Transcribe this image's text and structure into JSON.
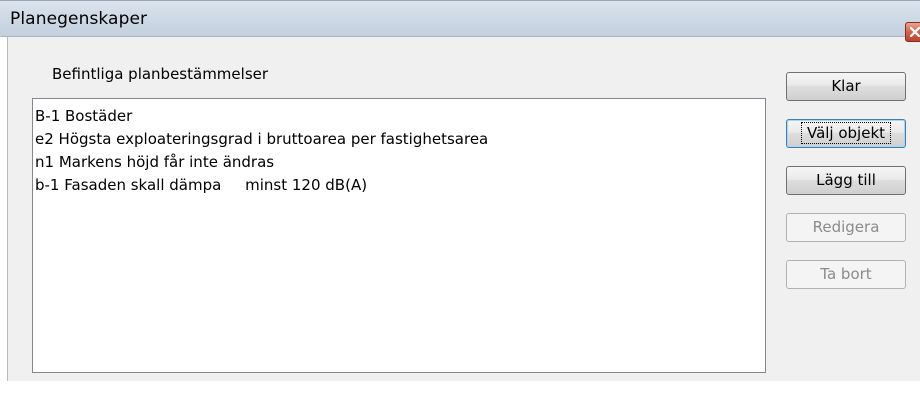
{
  "window": {
    "title": "Planegenskaper",
    "close_icon": "close-icon"
  },
  "group": {
    "label": "Befintliga planbestämmelser"
  },
  "list": {
    "items": [
      "B-1 Bostäder",
      "e2 Högsta exploateringsgrad i bruttoarea per fastighetsarea",
      "n1 Markens höjd får inte ändras",
      "b-1 Fasaden skall dämpa     minst 120 dB(A)"
    ]
  },
  "buttons": {
    "done": "Klar",
    "select_object": "Välj objekt",
    "add": "Lägg till",
    "edit": "Redigera",
    "remove": "Ta bort"
  },
  "colors": {
    "titlebar": "#cfdae6",
    "disabled_text": "#8b8b8b",
    "focus_border": "#3c7fb1"
  }
}
